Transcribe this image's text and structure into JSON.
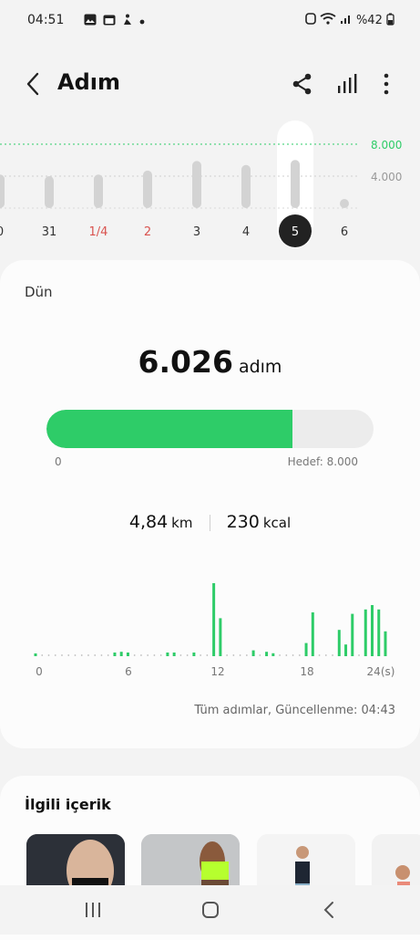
{
  "status": {
    "time": "04:51",
    "battery": "%42",
    "icons": [
      "image-icon",
      "calendar-icon",
      "fitness-icon",
      "dot-icon"
    ]
  },
  "header": {
    "title": "Adım",
    "back_icon": "chevron-left-icon",
    "actions": [
      "share-icon",
      "chart-bars-icon",
      "more-vert-icon"
    ]
  },
  "week": {
    "labels": [
      "0",
      "31",
      "1/4",
      "2",
      "3",
      "4",
      "5",
      "6"
    ],
    "label_colors": [
      "#333333",
      "#333333",
      "#d9534f",
      "#d9534f",
      "#333333",
      "#333333",
      "#ffffff",
      "#333333"
    ],
    "selected_index": 6,
    "values": [
      4200,
      4000,
      4200,
      4700,
      5900,
      5400,
      6026,
      0
    ],
    "goal_label": "8.000",
    "mid_label": "4.000",
    "goal_color": "#2ecc68"
  },
  "today": {
    "day_label": "Dün",
    "steps": "6.026",
    "steps_unit": "adım",
    "progress_fraction": 0.753,
    "progress_start": "0",
    "goal_text": "Hedef: 8.000",
    "distance": "4,84",
    "distance_unit": "km",
    "calories": "230",
    "calories_unit": "kcal",
    "accent_color": "#2ecc68"
  },
  "hourly": {
    "x_labels": [
      "0",
      "6",
      "12",
      "18",
      "24(s)"
    ],
    "values": [
      0.02,
      0,
      0,
      0,
      0,
      0,
      0,
      0,
      0,
      0,
      0,
      0,
      0.05,
      0.06,
      0.05,
      0,
      0,
      0,
      0,
      0,
      0.05,
      0.05,
      0,
      0,
      0.05,
      0,
      0,
      1.0,
      0.52,
      0,
      0,
      0,
      0,
      0.08,
      0,
      0.06,
      0.04,
      0,
      0,
      0,
      0,
      0.18,
      0.6,
      0,
      0,
      0,
      0.36,
      0.16,
      0.58,
      0,
      0.64,
      0.7,
      0.64,
      0.34
    ],
    "updated_text": "Tüm adımlar, Güncellenme: 04:43"
  },
  "related": {
    "title": "İlgili içerik"
  },
  "nav": {
    "icons": [
      "recents-icon",
      "home-icon",
      "back-icon"
    ]
  }
}
